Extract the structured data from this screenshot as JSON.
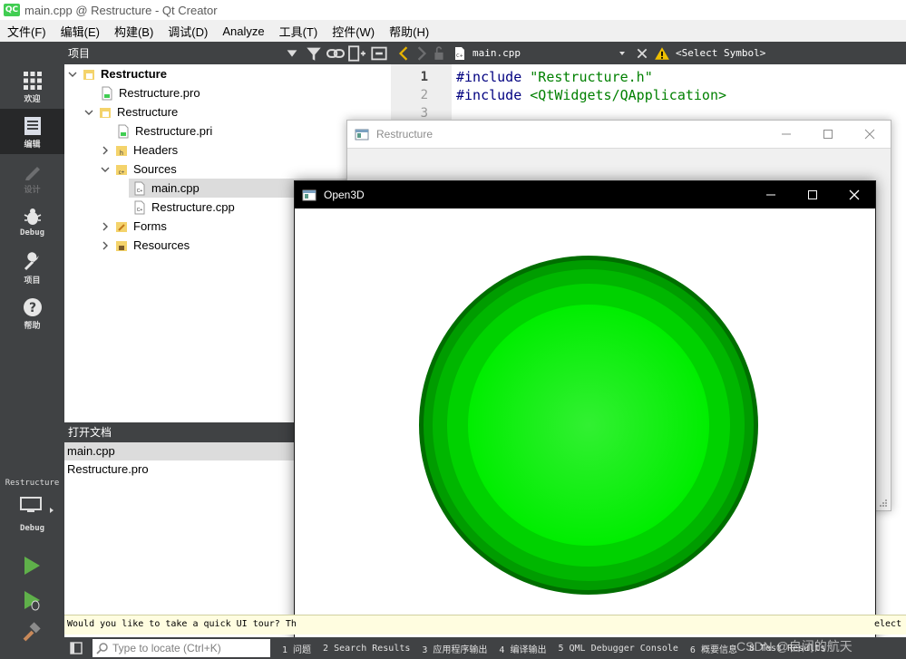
{
  "window": {
    "title": "main.cpp @ Restructure - Qt Creator",
    "logo": "QC"
  },
  "menubar": [
    "文件(F)",
    "编辑(E)",
    "构建(B)",
    "调试(D)",
    "Analyze",
    "工具(T)",
    "控件(W)",
    "帮助(H)"
  ],
  "modes": [
    {
      "label": "欢迎",
      "icon": "grid-icon"
    },
    {
      "label": "编辑",
      "icon": "edit-document-icon"
    },
    {
      "label": "设计",
      "icon": "pencil-icon"
    },
    {
      "label": "Debug",
      "icon": "bug-icon"
    },
    {
      "label": "项目",
      "icon": "wrench-icon"
    },
    {
      "label": "帮助",
      "icon": "help-icon"
    }
  ],
  "kit": {
    "project": "Restructure",
    "build": "Debug"
  },
  "project_pane": {
    "title": "项目",
    "tree": [
      {
        "label": "Restructure",
        "bold": true
      },
      {
        "label": "Restructure.pro"
      },
      {
        "label": "Restructure"
      },
      {
        "label": "Restructure.pri"
      },
      {
        "label": "Headers"
      },
      {
        "label": "Sources"
      },
      {
        "label": "main.cpp"
      },
      {
        "label": "Restructure.cpp"
      },
      {
        "label": "Forms"
      },
      {
        "label": "Resources"
      }
    ]
  },
  "open_docs": {
    "title": "打开文档",
    "items": [
      "main.cpp",
      "Restructure.pro"
    ]
  },
  "editor": {
    "file": "main.cpp",
    "symbol": "<Select Symbol>",
    "lines": [
      {
        "num": "1",
        "kw": "#include",
        "rest": " \"Restructure.h\""
      },
      {
        "num": "2",
        "kw": "#include",
        "rest": " <QtWidgets/QApplication>"
      },
      {
        "num": "3",
        "kw": "",
        "rest": ""
      }
    ]
  },
  "restructure_window": {
    "title": "Restructure"
  },
  "open3d_window": {
    "title": "Open3D"
  },
  "tour_bar": "Would you like to take a quick UI tour? Th",
  "tour_bar_tail": "elect",
  "statusbar": {
    "locator_placeholder": "Type to locate (Ctrl+K)",
    "tabs": [
      "1 问题",
      "2 Search Results",
      "3 应用程序输出",
      "4 编译输出",
      "5 QML Debugger Console",
      "6 概要信息",
      "8 Test Results"
    ]
  },
  "watermark": "CSDN @自闭的航天",
  "colors": {
    "qt_green": "#41cd52",
    "dark_panel": "#404244",
    "sphere_outer": "#006e00",
    "sphere_inner": "#00ee00"
  }
}
